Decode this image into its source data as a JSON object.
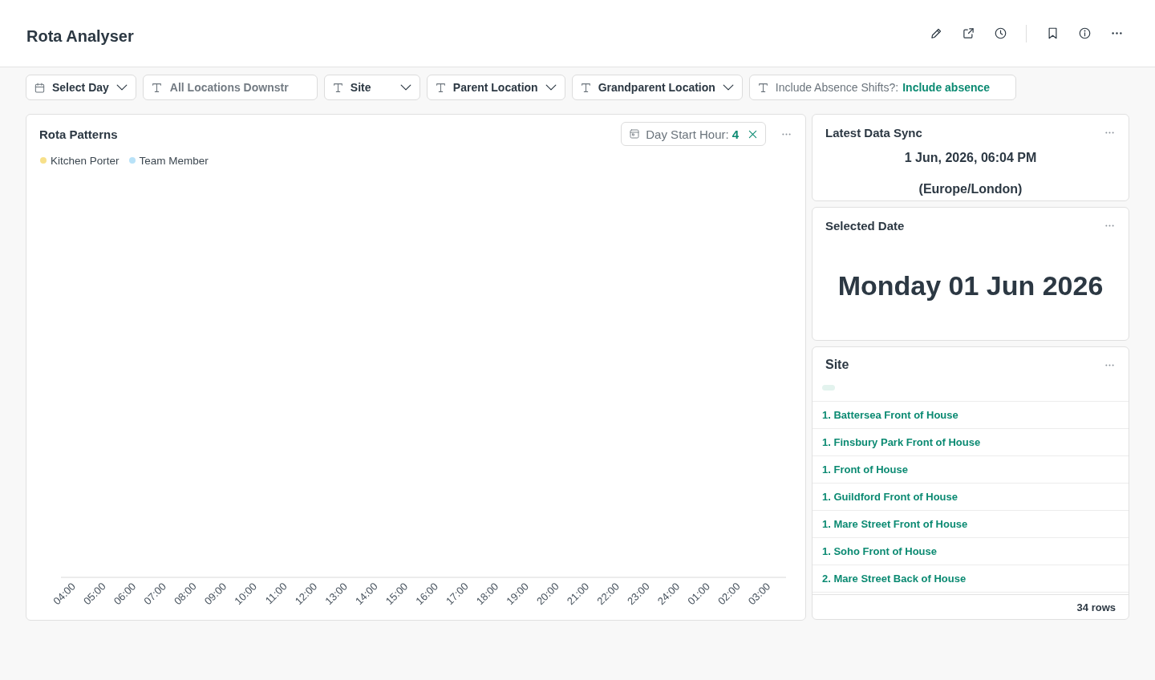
{
  "header": {
    "title": "Rota Analyser"
  },
  "filters": [
    {
      "kind": "date",
      "label": "Select Day"
    },
    {
      "kind": "search",
      "placeholder": "All Locations Downstr"
    },
    {
      "kind": "select",
      "label": "Site"
    },
    {
      "kind": "select",
      "label": "Parent Location"
    },
    {
      "kind": "select",
      "label": "Grandparent Location"
    },
    {
      "kind": "value",
      "label": "Include Absence Shifts?:",
      "value": "Include absence"
    }
  ],
  "rota_patterns": {
    "title": "Rota Patterns",
    "parameter": {
      "label": "Day Start Hour:",
      "value": "4"
    },
    "legend": [
      {
        "name": "Kitchen Porter",
        "color": "#f7e08a"
      },
      {
        "name": "Team Member",
        "color": "#b8e2f8"
      }
    ],
    "x_axis_labels": [
      "04:00",
      "05:00",
      "06:00",
      "07:00",
      "08:00",
      "09:00",
      "10:00",
      "11:00",
      "12:00",
      "13:00",
      "14:00",
      "15:00",
      "16:00",
      "17:00",
      "18:00",
      "19:00",
      "20:00",
      "21:00",
      "22:00",
      "23:00",
      "24:00",
      "01:00",
      "02:00",
      "03:00"
    ]
  },
  "latest_data_sync": {
    "title": "Latest Data Sync",
    "value": "1 Jun, 2026, 06:04 PM",
    "timezone": "(Europe/London)"
  },
  "selected_date": {
    "title": "Selected Date",
    "value": "Monday 01 Jun 2026"
  },
  "site": {
    "title": "Site",
    "rows": [
      "1. Battersea Front of House",
      "1. Finsbury Park Front of House",
      "1. Front of House",
      "1. Guildford Front of House",
      "1. Mare Street Front of House",
      "1. Soho Front of House",
      "2. Mare Street Back of House"
    ],
    "row_count": "34 rows"
  }
}
